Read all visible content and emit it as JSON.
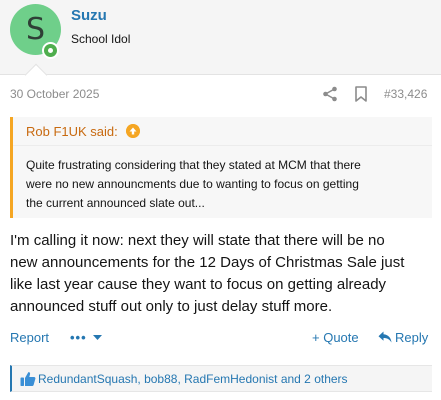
{
  "post": {
    "author": {
      "initial": "S",
      "name": "Suzu",
      "title": "School Idol"
    },
    "date": "30 October 2025",
    "number": "#33,426",
    "quote": {
      "header": "Rob F1UK said:",
      "line1": "Quite frustrating considering that they stated at MCM that there",
      "line2": "were no new announcments due to wanting to focus on getting",
      "line3": "the current announced slate out..."
    },
    "body": {
      "line1": "I'm calling it now: next they will state that there will be no",
      "line2": "new announcements for the 12 Days of Christmas Sale just",
      "line3": "like last year cause they want to focus on getting already",
      "line4": "announced stuff out only to just delay stuff more."
    },
    "actions": {
      "report": "Report",
      "more": "•••",
      "quote": "+ Quote",
      "reply": "Reply"
    },
    "reactions": "RedundantSquash, bob88, RadFemHedonist and 2 others"
  },
  "colors": {
    "link": "#2577b1",
    "quote_accent": "#f5a623",
    "avatar_bg": "#6fcf8a",
    "online": "#4fae4e"
  },
  "icons": [
    "share-icon",
    "bookmark-icon",
    "quote-arrow-icon",
    "chevron-down-icon",
    "reply-icon",
    "like-icon"
  ]
}
